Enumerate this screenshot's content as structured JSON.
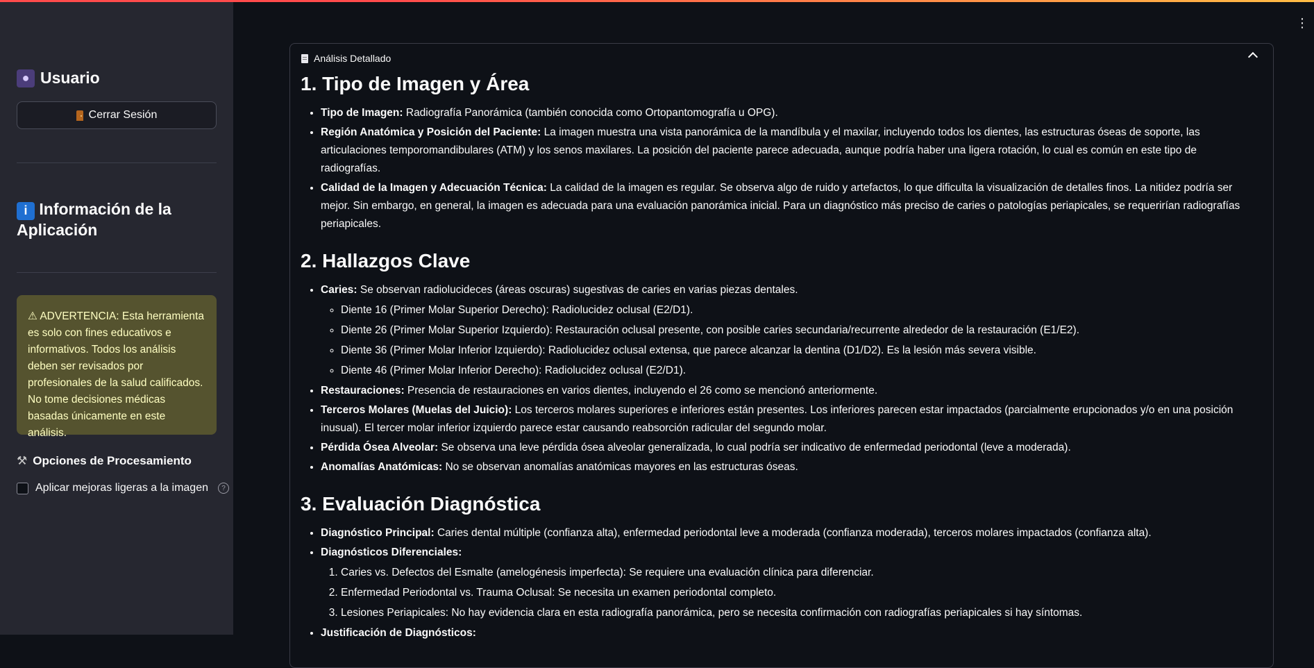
{
  "sidebar": {
    "user_heading": "Usuario",
    "logout_label": "Cerrar Sesión",
    "info_heading": "Información de la Aplicación",
    "warning_text": "⚠ ADVERTENCIA: Esta herramienta es solo con fines educativos e informativos. Todos los análisis deben ser revisados por profesionales de la salud calificados. No tome decisiones médicas basadas únicamente en este análisis.",
    "options_heading": "Opciones de Procesamiento",
    "checkbox_label": "Aplicar mejoras ligeras a la imagen",
    "checkbox_checked": false
  },
  "expander": {
    "title": "Análisis Detallado",
    "expanded": true
  },
  "report": {
    "s1": {
      "title": "1. Tipo de Imagen y Área",
      "items": [
        {
          "label": "Tipo de Imagen:",
          "text": " Radiografía Panorámica (también conocida como Ortopantomografía u OPG)."
        },
        {
          "label": "Región Anatómica y Posición del Paciente:",
          "text": " La imagen muestra una vista panorámica de la mandíbula y el maxilar, incluyendo todos los dientes, las estructuras óseas de soporte, las articulaciones temporomandibulares (ATM) y los senos maxilares. La posición del paciente parece adecuada, aunque podría haber una ligera rotación, lo cual es común en este tipo de radiografías."
        },
        {
          "label": "Calidad de la Imagen y Adecuación Técnica:",
          "text": " La calidad de la imagen es regular. Se observa algo de ruido y artefactos, lo que dificulta la visualización de detalles finos. La nitidez podría ser mejor. Sin embargo, en general, la imagen es adecuada para una evaluación panorámica inicial. Para un diagnóstico más preciso de caries o patologías periapicales, se requerirían radiografías periapicales."
        }
      ]
    },
    "s2": {
      "title": "2. Hallazgos Clave",
      "caries_label": "Caries:",
      "caries_text": " Se observan radiolucideces (áreas oscuras) sugestivas de caries en varias piezas dentales.",
      "caries_sub": [
        "Diente 16 (Primer Molar Superior Derecho): Radiolucidez oclusal (E2/D1).",
        "Diente 26 (Primer Molar Superior Izquierdo): Restauración oclusal presente, con posible caries secundaria/recurrente alrededor de la restauración (E1/E2).",
        "Diente 36 (Primer Molar Inferior Izquierdo): Radiolucidez oclusal extensa, que parece alcanzar la dentina (D1/D2). Es la lesión más severa visible.",
        "Diente 46 (Primer Molar Inferior Derecho): Radiolucidez oclusal (E2/D1)."
      ],
      "items": [
        {
          "label": "Restauraciones:",
          "text": " Presencia de restauraciones en varios dientes, incluyendo el 26 como se mencionó anteriormente."
        },
        {
          "label": "Terceros Molares (Muelas del Juicio):",
          "text": " Los terceros molares superiores e inferiores están presentes. Los inferiores parecen estar impactados (parcialmente erupcionados y/o en una posición inusual). El tercer molar inferior izquierdo parece estar causando reabsorción radicular del segundo molar."
        },
        {
          "label": "Pérdida Ósea Alveolar:",
          "text": " Se observa una leve pérdida ósea alveolar generalizada, lo cual podría ser indicativo de enfermedad periodontal (leve a moderada)."
        },
        {
          "label": "Anomalías Anatómicas:",
          "text": " No se observan anomalías anatómicas mayores en las estructuras óseas."
        }
      ]
    },
    "s3": {
      "title": "3. Evaluación Diagnóstica",
      "principal_label": "Diagnóstico Principal:",
      "principal_text": " Caries dental múltiple (confianza alta), enfermedad periodontal leve a moderada (confianza moderada), terceros molares impactados (confianza alta).",
      "diferenciales_label": "Diagnósticos Diferenciales:",
      "diferenciales": [
        "Caries vs. Defectos del Esmalte (amelogénesis imperfecta): Se requiere una evaluación clínica para diferenciar.",
        "Enfermedad Periodontal vs. Trauma Oclusal: Se necesita un examen periodontal completo.",
        "Lesiones Periapicales: No hay evidencia clara en esta radiografía panorámica, pero se necesita confirmación con radiografías periapicales si hay síntomas."
      ],
      "justificacion_label": "Justificación de Diagnósticos:"
    }
  }
}
